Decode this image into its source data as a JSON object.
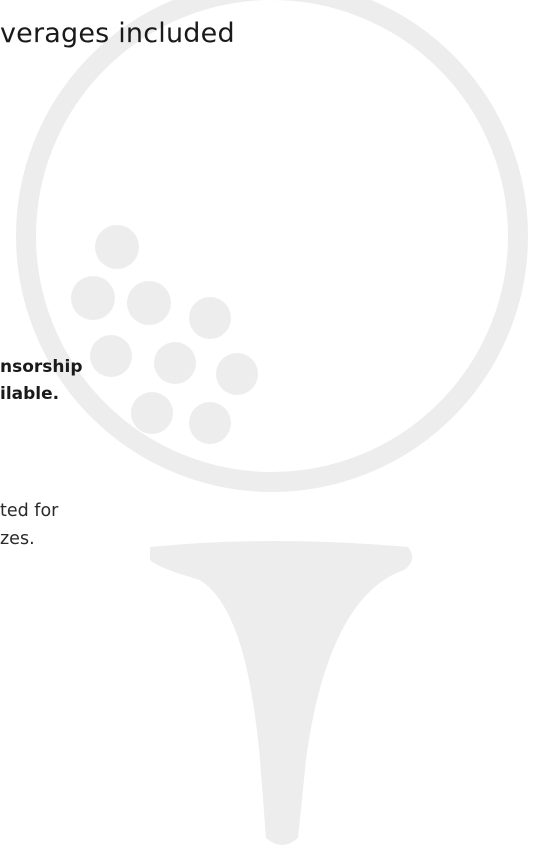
{
  "headline": "verages included",
  "sponsorship": {
    "line1": "nsorship",
    "line2": "ilable."
  },
  "prizes": {
    "line1": "ted for",
    "line2": "zes."
  },
  "icons": {
    "background_art": "golf-ball-on-tee-icon"
  },
  "colors": {
    "background": "#ffffff",
    "art": "#ededed",
    "text": "#1a1a1a"
  }
}
